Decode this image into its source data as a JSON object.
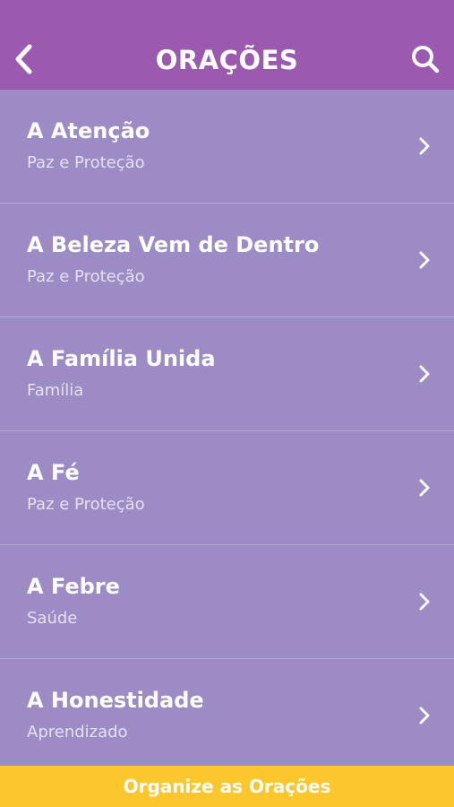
{
  "header": {
    "title": "ORAÇÕES",
    "back_icon": "chevron-left-icon",
    "search_icon": "search-icon"
  },
  "items": [
    {
      "title": "A Atenção",
      "subtitle": "Paz e Proteção"
    },
    {
      "title": "A Beleza Vem de Dentro",
      "subtitle": "Paz e Proteção"
    },
    {
      "title": "A Família Unida",
      "subtitle": "Família"
    },
    {
      "title": "A Fé",
      "subtitle": "Paz e Proteção"
    },
    {
      "title": "A Febre",
      "subtitle": "Saúde"
    },
    {
      "title": "A Honestidade",
      "subtitle": "Aprendizado"
    }
  ],
  "footer": {
    "label": "Organize as Orações"
  },
  "colors": {
    "header_bg": "#9b59b0",
    "list_bg": "#9d8bc6",
    "footer_bg": "#fcc72c",
    "text": "#ffffff"
  }
}
